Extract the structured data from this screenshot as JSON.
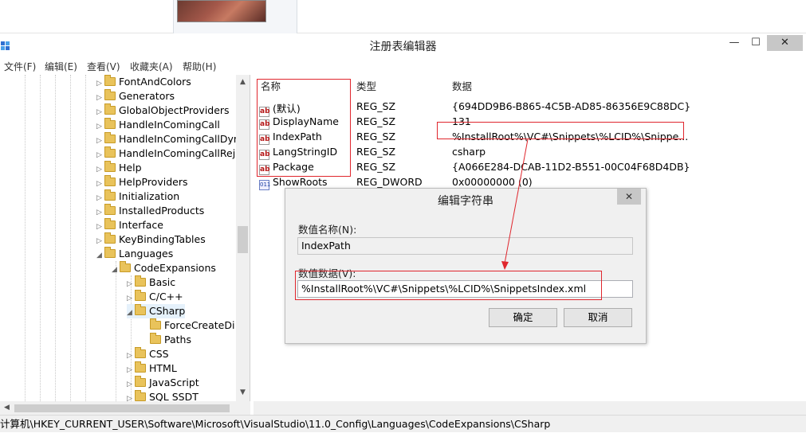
{
  "window": {
    "title": "注册表编辑器",
    "minimize_glyph": "—",
    "maximize_glyph": "☐",
    "close_glyph": "✕"
  },
  "menu": [
    "文件(F)",
    "编辑(E)",
    "查看(V)",
    "收藏夹(A)",
    "帮助(H)"
  ],
  "tree": {
    "nodes": [
      {
        "label": "FontAndColors",
        "arrow": "▷"
      },
      {
        "label": "Generators",
        "arrow": "▷"
      },
      {
        "label": "GlobalObjectProviders",
        "arrow": "▷"
      },
      {
        "label": "HandleInComingCall",
        "arrow": "▷"
      },
      {
        "label": "HandleInComingCallDyn",
        "arrow": "▷"
      },
      {
        "label": "HandleInComingCallReje",
        "arrow": "▷"
      },
      {
        "label": "Help",
        "arrow": "▷"
      },
      {
        "label": "HelpProviders",
        "arrow": "▷"
      },
      {
        "label": "Initialization",
        "arrow": "▷"
      },
      {
        "label": "InstalledProducts",
        "arrow": "▷"
      },
      {
        "label": "Interface",
        "arrow": "▷"
      },
      {
        "label": "KeyBindingTables",
        "arrow": "▷"
      },
      {
        "label": "Languages",
        "arrow": "◢"
      },
      {
        "label": "CodeExpansions",
        "arrow": "◢"
      },
      {
        "label": "Basic",
        "arrow": "▷"
      },
      {
        "label": "C/C++",
        "arrow": "▷"
      },
      {
        "label": "CSharp",
        "arrow": "◢"
      },
      {
        "label": "ForceCreateDi",
        "arrow": ""
      },
      {
        "label": "Paths",
        "arrow": ""
      },
      {
        "label": "CSS",
        "arrow": "▷"
      },
      {
        "label": "HTML",
        "arrow": "▷"
      },
      {
        "label": "JavaScript",
        "arrow": "▷"
      },
      {
        "label": "SQL SSDT",
        "arrow": "▷"
      }
    ]
  },
  "list": {
    "columns": {
      "name": "名称",
      "type": "类型",
      "data": "数据"
    },
    "rows": [
      {
        "name": "(默认)",
        "type": "REG_SZ",
        "data": "{694DD9B6-B865-4C5B-AD85-86356E9C88DC}",
        "icon": "ab"
      },
      {
        "name": "DisplayName",
        "type": "REG_SZ",
        "data": "131",
        "icon": "ab"
      },
      {
        "name": "IndexPath",
        "type": "REG_SZ",
        "data": "%InstallRoot%\\VC#\\Snippets\\%LCID%\\Snippe...",
        "icon": "ab"
      },
      {
        "name": "LangStringID",
        "type": "REG_SZ",
        "data": "csharp",
        "icon": "ab"
      },
      {
        "name": "Package",
        "type": "REG_SZ",
        "data": "{A066E284-DCAB-11D2-B551-00C04F68D4DB}",
        "icon": "ab"
      },
      {
        "name": "ShowRoots",
        "type": "REG_DWORD",
        "data": "0x00000000 (0)",
        "icon": "011"
      }
    ]
  },
  "dialog": {
    "title": "编辑字符串",
    "close_glyph": "✕",
    "name_label": "数值名称(N):",
    "name_value": "IndexPath",
    "data_label": "数值数据(V):",
    "data_value": "%InstallRoot%\\VC#\\Snippets\\%LCID%\\SnippetsIndex.xml",
    "ok_label": "确定",
    "cancel_label": "取消"
  },
  "status": {
    "path": "计算机\\HKEY_CURRENT_USER\\Software\\Microsoft\\VisualStudio\\11.0_Config\\Languages\\CodeExpansions\\CSharp"
  },
  "colors": {
    "annotation": "#e0262d",
    "folder": "#e9c35b"
  }
}
